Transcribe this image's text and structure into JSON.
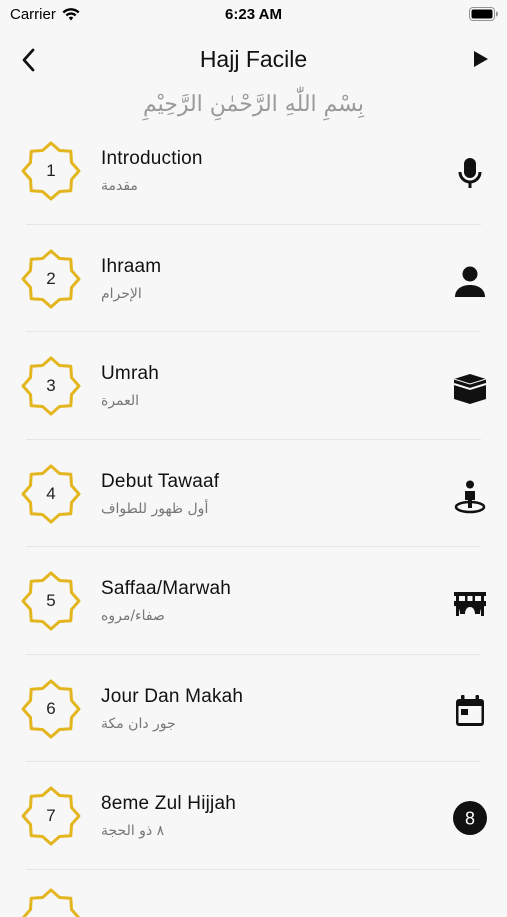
{
  "status": {
    "carrier": "Carrier",
    "time": "6:23 AM"
  },
  "nav": {
    "title": "Hajj Facile"
  },
  "header": {
    "bismillah": "بِسْمِ اللّٰهِ الرَّحْمٰنِ الرَّحِيْمِ"
  },
  "colors": {
    "accent": "#e3b51e",
    "background": "#f7f7f7"
  },
  "items": [
    {
      "number": "1",
      "title": "Introduction",
      "subtitle": "مقدمة",
      "icon": "microphone-icon"
    },
    {
      "number": "2",
      "title": "Ihraam",
      "subtitle": "الإحرام",
      "icon": "person-icon"
    },
    {
      "number": "3",
      "title": "Umrah",
      "subtitle": "العمرة",
      "icon": "kaaba-icon"
    },
    {
      "number": "4",
      "title": "Debut Tawaaf",
      "subtitle": "أول ظهور للطواف",
      "icon": "person-pin-icon"
    },
    {
      "number": "5",
      "title": "Saffaa/Marwah",
      "subtitle": "صفاء/مروه",
      "icon": "bridge-icon"
    },
    {
      "number": "6",
      "title": "Jour Dan Makah",
      "subtitle": "جور دان مكة",
      "icon": "calendar-icon"
    },
    {
      "number": "7",
      "title": "8eme Zul Hijjah",
      "subtitle": "٨ ذو الحجة",
      "icon": "number-8-icon",
      "icon_text": "8"
    }
  ]
}
